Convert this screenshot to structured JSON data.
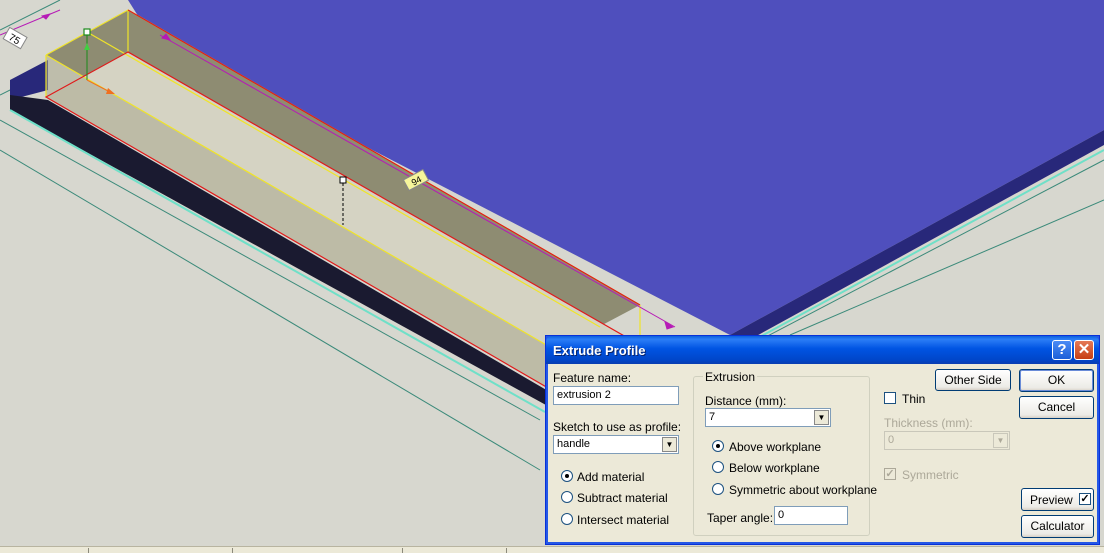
{
  "viewport": {
    "dimension_left": "75",
    "dimension_mid": "94",
    "colors": {
      "background": "#d7d7cf",
      "blue_face": "#4f4fbd",
      "blue_edge": "#28287a",
      "extrude_fill": "#8e8c72",
      "profile_fill": "#d5d3c3",
      "preview_outline": "#f0e428",
      "profile_outline": "#e01a1a",
      "dimension": "#b61ab6"
    }
  },
  "dialog": {
    "title": "Extrude Profile",
    "help_button": "?",
    "close_button": "✕",
    "feature_name_label": "Feature name:",
    "feature_name_value": "extrusion 2",
    "sketch_label": "Sketch to use as profile:",
    "sketch_value": "handle",
    "material_options": [
      "Add material",
      "Subtract material",
      "Intersect material"
    ],
    "material_selected": 0,
    "extrusion_group_label": "Extrusion",
    "distance_label": "Distance (mm):",
    "distance_value": "7",
    "direction_options": [
      "Above workplane",
      "Below workplane",
      "Symmetric about workplane"
    ],
    "direction_selected": 0,
    "taper_label": "Taper angle:",
    "taper_value": "0",
    "other_side_button": "Other Side",
    "thin_label": "Thin",
    "thin_checked": false,
    "thickness_label": "Thickness (mm):",
    "thickness_value": "0",
    "symmetric_label": "Symmetric",
    "symmetric_checked": true,
    "ok_button": "OK",
    "cancel_button": "Cancel",
    "preview_button": "Preview",
    "preview_checked": true,
    "calculator_button": "Calculator"
  }
}
